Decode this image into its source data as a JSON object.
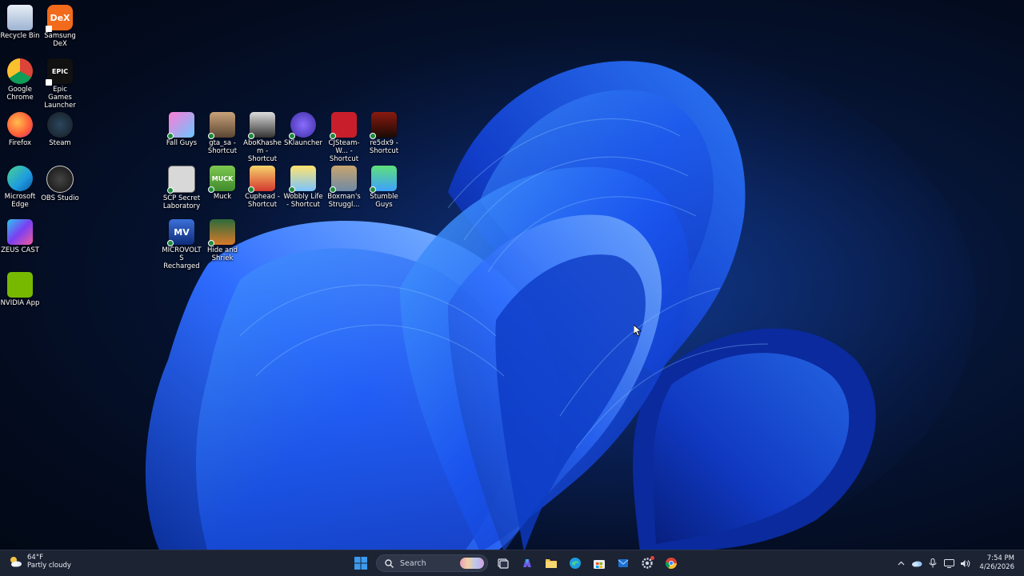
{
  "desktop": {
    "icons": [
      {
        "label": "Recycle Bin",
        "icon": "recycle-bin-icon"
      },
      {
        "label": "Samsung DeX",
        "icon": "samsung-dex-icon",
        "badge": "DeX"
      },
      {
        "label": "Google Chrome",
        "icon": "chrome-icon"
      },
      {
        "label": "Epic Games Launcher",
        "icon": "epic-games-icon",
        "badge": "EPIC"
      },
      {
        "label": "Firefox",
        "icon": "firefox-icon"
      },
      {
        "label": "Steam",
        "icon": "steam-icon"
      },
      {
        "label": "Microsoft Edge",
        "icon": "edge-icon"
      },
      {
        "label": "OBS Studio",
        "icon": "obs-icon"
      },
      {
        "label": "ZEUS CAST",
        "icon": "zeus-cast-icon"
      },
      {
        "label": "NVIDIA App",
        "icon": "nvidia-icon"
      },
      {
        "label": "Fall Guys",
        "icon": "fall-guys-icon"
      },
      {
        "label": "gta_sa - Shortcut",
        "icon": "gta-sa-icon"
      },
      {
        "label": "AboKhashem - Shortcut",
        "icon": "abokhashem-icon"
      },
      {
        "label": "SKlauncher",
        "icon": "sklauncher-icon"
      },
      {
        "label": "CJSteam-W... - Shortcut",
        "icon": "cjsteam-icon"
      },
      {
        "label": "re5dx9 - Shortcut",
        "icon": "re5-icon"
      },
      {
        "label": "SCP Secret Laboratory",
        "icon": "scp-icon"
      },
      {
        "label": "Muck",
        "icon": "muck-icon",
        "badge": "MUCK"
      },
      {
        "label": "Cuphead - Shortcut",
        "icon": "cuphead-icon"
      },
      {
        "label": "Wobbly Life - Shortcut",
        "icon": "wobbly-life-icon"
      },
      {
        "label": "Boxman's Struggl...",
        "icon": "boxman-icon"
      },
      {
        "label": "Stumble Guys",
        "icon": "stumble-guys-icon"
      },
      {
        "label": "MICROVOLTS Recharged",
        "icon": "microvolts-icon",
        "badge": "MV"
      },
      {
        "label": "Hide and Shriek",
        "icon": "hide-and-shriek-icon"
      }
    ]
  },
  "taskbar": {
    "weather": {
      "temp": "64°F",
      "condition": "Partly cloudy"
    },
    "search_label": "Search",
    "clock": {
      "time": "7:54 PM",
      "date": "4/26/2026"
    }
  },
  "colors": {
    "taskbar": "#1c2333",
    "accent": "#1c7ad6",
    "wallpaper_bloom": "#1f5cff"
  }
}
